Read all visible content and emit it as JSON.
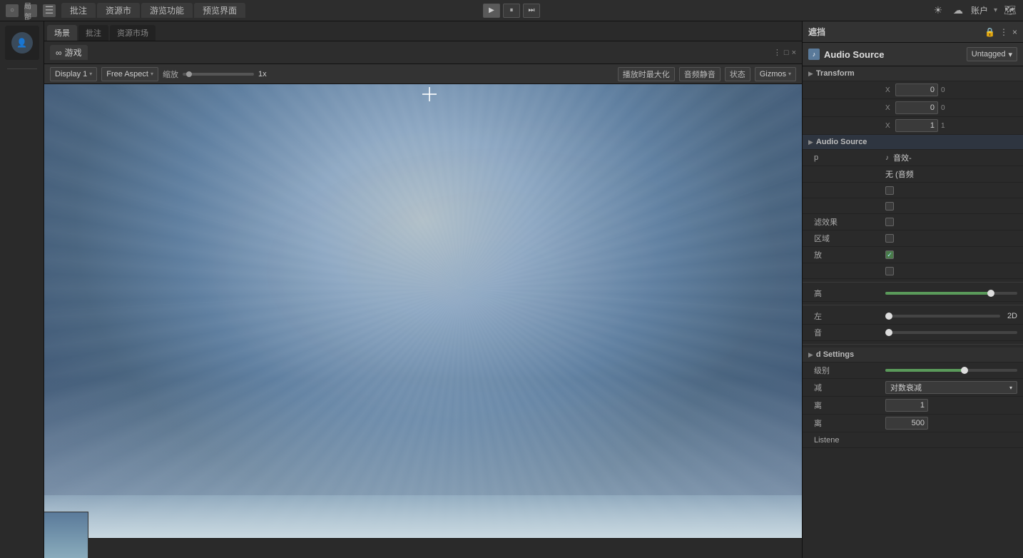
{
  "topbar": {
    "logo1": "○",
    "logo2": "局部",
    "logo3": "☰",
    "tabs": [
      {
        "label": "批注",
        "active": false
      },
      {
        "label": "资源市",
        "active": false
      },
      {
        "label": "游览功能",
        "active": false
      },
      {
        "label": "预览界面",
        "active": false
      }
    ],
    "play_label": "▶",
    "pause_label": "⏸",
    "step_label": "⏭",
    "sun_icon": "☀",
    "cloud_icon": "☁",
    "account_label": "账户",
    "arrow_icon": "▾",
    "map_icon": "🗺"
  },
  "left_sidebar": {
    "icons": []
  },
  "game_panel": {
    "tab_icon": "∞",
    "tab_label": "游戏",
    "close_btn": "×",
    "maximize_btn": "□",
    "menu_btn": "⋮"
  },
  "game_toolbar": {
    "display_label": "Display 1",
    "aspect_label": "Free Aspect",
    "scale_label": "缩放",
    "scale_value": "1x",
    "maximize_btn": "播放时最大化",
    "mute_btn": "音频静音",
    "stats_btn": "状态",
    "gizmos_btn": "Gizmos",
    "gizmos_arrow": "▾"
  },
  "right_panel": {
    "header_title": "遮挡",
    "title": "Audio Source",
    "tag_dropdown": "Untagged",
    "tag_arrow": "▾",
    "transform_section": "Transform",
    "transform_x_label": "X",
    "transform_x_value": "0",
    "transform_y_label": "X",
    "transform_y_value": "0",
    "transform_z_label": "X",
    "transform_z_value": "1",
    "audio_source_section": "Audio Source",
    "clip_label": "p",
    "clip_icon": "♪",
    "clip_value": "音效-",
    "no_audio_label": "无 (音频",
    "checkbox_label1": "",
    "blur_effects_label": "滤效果",
    "area_label": "区域",
    "play_label": "放",
    "checkbox_checked": true,
    "volume_label": "高",
    "pan_label": "左",
    "pan_value": "2D",
    "reverb_label": "音",
    "reverb_section": "d Settings",
    "priority_label": "级别",
    "rolloff_label": "减",
    "rolloff_value": "对数衰减",
    "min_dist_label": "离",
    "min_dist_value": "1",
    "max_dist_label": "离",
    "max_dist_value": "500",
    "listener_label": "Listene"
  }
}
